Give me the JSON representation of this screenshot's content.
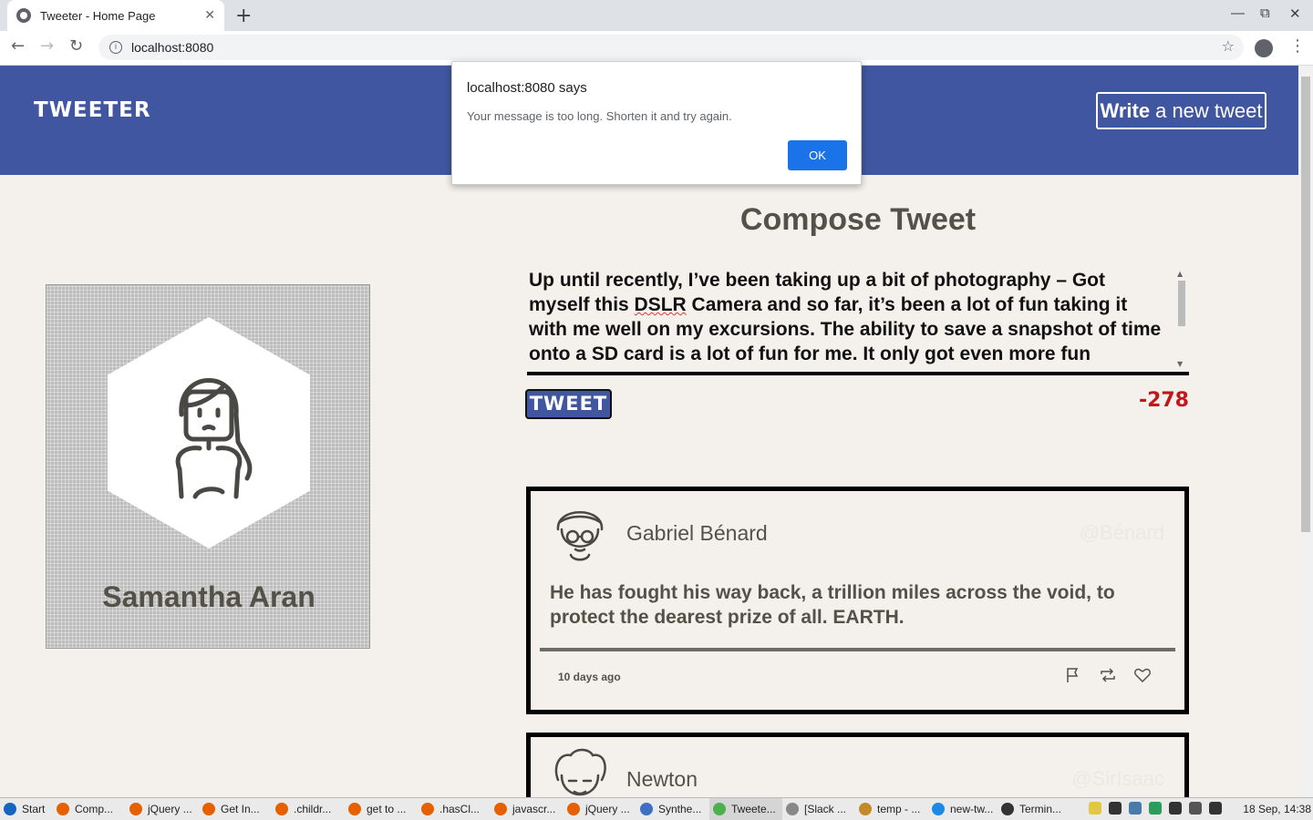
{
  "browser": {
    "tab_title": "Tweeter - Home Page",
    "new_tab": "+",
    "tab_close": "✕",
    "url": "localhost:8080",
    "back": "←",
    "forward": "→",
    "reload": "↻",
    "star": "☆",
    "menu": "⋮",
    "minimize": "—",
    "maximize": "⧉",
    "close": "✕"
  },
  "header": {
    "brand": "TWEETER",
    "write_bold": "Write",
    "write_rest": "a new tweet"
  },
  "profile": {
    "name": "Samantha Aran"
  },
  "compose": {
    "title": "Compose Tweet",
    "text_before": "Up until recently, I’ve been taking up a bit of photography – Got myself this ",
    "text_flagged": "DSLR",
    "text_after": " Camera and so far, it’s been a lot of fun taking it with me well on my excursions. The ability to save a snapshot of time onto a SD card is a lot of fun for me. It only got even more fun",
    "button": "TWEET",
    "counter": "-278"
  },
  "tweets": [
    {
      "name": "Gabriel Bénard",
      "handle": "@Bénard",
      "body": "He has fought his way back, a trillion miles across the void, to protect the dearest prize of all. EARTH.",
      "date": "10 days ago",
      "actions": [
        "flag-icon",
        "retweet-icon",
        "heart-icon"
      ]
    },
    {
      "name": "Newton",
      "handle": "@SirIsaac"
    }
  ],
  "alert": {
    "title": "localhost:8080 says",
    "message": "Your message is too long. Shorten it and try again.",
    "ok": "OK"
  },
  "taskbar": {
    "items": [
      {
        "label": "Start",
        "color": "#1565c0"
      },
      {
        "label": "Comp...",
        "color": "#e66000"
      },
      {
        "label": "jQuery ...",
        "color": "#e66000"
      },
      {
        "label": "Get In...",
        "color": "#e66000"
      },
      {
        "label": ".childr...",
        "color": "#e66000"
      },
      {
        "label": "get to ...",
        "color": "#e66000"
      },
      {
        "label": ".hasCl...",
        "color": "#e66000"
      },
      {
        "label": "javascr...",
        "color": "#e66000"
      },
      {
        "label": "jQuery ...",
        "color": "#e66000"
      },
      {
        "label": "Synthe...",
        "color": "#3f6fc4"
      },
      {
        "label": "Tweete...",
        "color": "#4caf50"
      },
      {
        "label": "[Slack ...",
        "color": "#888888"
      },
      {
        "label": "temp - ...",
        "color": "#c48a2a"
      },
      {
        "label": "new-tw...",
        "color": "#1e88e5"
      },
      {
        "label": "Termin...",
        "color": "#333333"
      }
    ],
    "clock": "18 Sep, 14:38"
  },
  "colors": {
    "header_bg": "#4056a1",
    "page_bg": "#f4f1ec",
    "counter_red": "#c0171d",
    "ok_blue": "#1a73e8"
  }
}
